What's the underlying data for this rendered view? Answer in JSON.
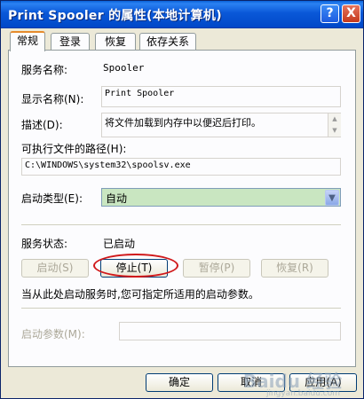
{
  "window": {
    "title": "Print Spooler 的属性(本地计算机)"
  },
  "titlebar_buttons": {
    "help": "?",
    "close": "X"
  },
  "tabs": [
    {
      "label": "常规",
      "active": true
    },
    {
      "label": "登录",
      "active": false
    },
    {
      "label": "恢复",
      "active": false
    },
    {
      "label": "依存关系",
      "active": false
    }
  ],
  "general": {
    "service_name_label": "服务名称:",
    "service_name_value": "Spooler",
    "display_name_label": "显示名称(N):",
    "display_name_value": "Print Spooler",
    "description_label": "描述(D):",
    "description_value": "将文件加载到内存中以便迟后打印。",
    "exe_path_label": "可执行文件的路径(H):",
    "exe_path_value": "C:\\WINDOWS\\system32\\spoolsv.exe",
    "startup_type_label": "启动类型(E):",
    "startup_type_value": "自动",
    "service_status_label": "服务状态:",
    "service_status_value": "已启动",
    "start_button": "启动(S)",
    "stop_button": "停止(T)",
    "pause_button": "暂停(P)",
    "resume_button": "恢复(R)",
    "hint_text": "当从此处启动服务时,您可指定所适用的启动参数。",
    "start_params_label": "启动参数(M):",
    "start_params_value": ""
  },
  "footer": {
    "ok_button": "确定",
    "cancel_button": "取消",
    "apply_button": "应用(A)"
  },
  "watermark": {
    "logo_text": "Baidu 经验",
    "sub_text": "jingyan.baidu.com"
  },
  "colors": {
    "title_bar": "#0a58d8",
    "accent_tab": "#e68b2c",
    "highlight_ring": "#d0181a",
    "startup_field_bg": "#c9e6c1"
  }
}
